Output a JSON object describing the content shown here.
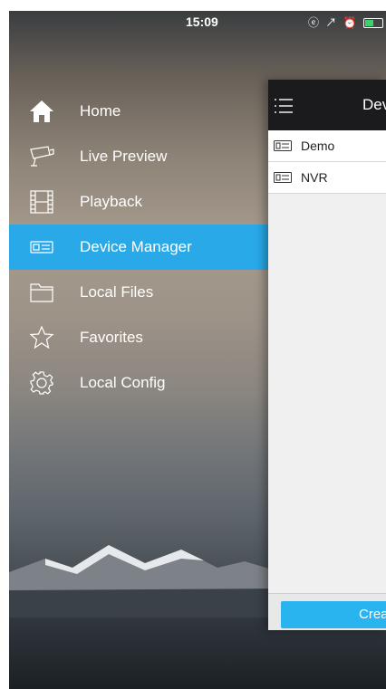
{
  "status_bar": {
    "time": "15:09",
    "icons": "ⓔ ↗ ⏰"
  },
  "menu": {
    "items": [
      {
        "label": "Home",
        "icon": "home-icon"
      },
      {
        "label": "Live Preview",
        "icon": "camera-icon"
      },
      {
        "label": "Playback",
        "icon": "film-icon"
      },
      {
        "label": "Device Manager",
        "icon": "device-icon",
        "active": true
      },
      {
        "label": "Local Files",
        "icon": "folder-icon"
      },
      {
        "label": "Favorites",
        "icon": "star-icon"
      },
      {
        "label": "Local Config",
        "icon": "gear-icon"
      }
    ]
  },
  "panel": {
    "title": "Dev",
    "devices": [
      "Demo",
      "NVR"
    ],
    "create_label": "Crea"
  },
  "colors": {
    "accent": "#29a9e8",
    "button": "#29b4f0",
    "topbar": "#1b1b1d"
  }
}
